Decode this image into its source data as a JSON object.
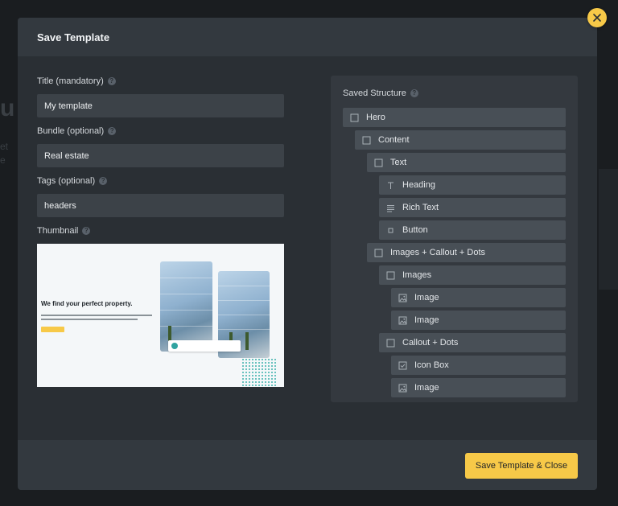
{
  "background": {
    "ghost_heading": "u",
    "ghost_line_1": "et",
    "ghost_line_2": "e"
  },
  "modal": {
    "title": "Save Template"
  },
  "fields": {
    "title": {
      "label": "Title (mandatory)",
      "value": "My template"
    },
    "bundle": {
      "label": "Bundle (optional)",
      "value": "Real estate"
    },
    "tags": {
      "label": "Tags (optional)",
      "value": "headers"
    },
    "thumbnail": {
      "label": "Thumbnail",
      "headline": "We find your perfect property."
    }
  },
  "help_icon_glyph": "?",
  "structure": {
    "title": "Saved Structure",
    "items": [
      {
        "label": "Hero",
        "icon": "square-icon",
        "depth": 0
      },
      {
        "label": "Content",
        "icon": "square-icon",
        "depth": 1
      },
      {
        "label": "Text",
        "icon": "square-icon",
        "depth": 2
      },
      {
        "label": "Heading",
        "icon": "heading-icon",
        "depth": 3
      },
      {
        "label": "Rich Text",
        "icon": "text-lines-icon",
        "depth": 3
      },
      {
        "label": "Button",
        "icon": "small-square-icon",
        "depth": 3
      },
      {
        "label": "Images + Callout + Dots",
        "icon": "square-icon",
        "depth": 2
      },
      {
        "label": "Images",
        "icon": "square-icon",
        "depth": 3
      },
      {
        "label": "Image",
        "icon": "image-icon",
        "depth": 4
      },
      {
        "label": "Image",
        "icon": "image-icon",
        "depth": 4
      },
      {
        "label": "Callout + Dots",
        "icon": "square-icon",
        "depth": 3
      },
      {
        "label": "Icon Box",
        "icon": "checkbox-icon",
        "depth": 4
      },
      {
        "label": "Image",
        "icon": "image-icon",
        "depth": 4
      }
    ]
  },
  "footer": {
    "save_label": "Save Template & Close"
  },
  "colors": {
    "accent": "#f7c948",
    "modal_bg": "#2a2f34",
    "header_bg": "#33393f",
    "input_bg": "#3c4248",
    "tree_item_bg": "#484f56"
  }
}
